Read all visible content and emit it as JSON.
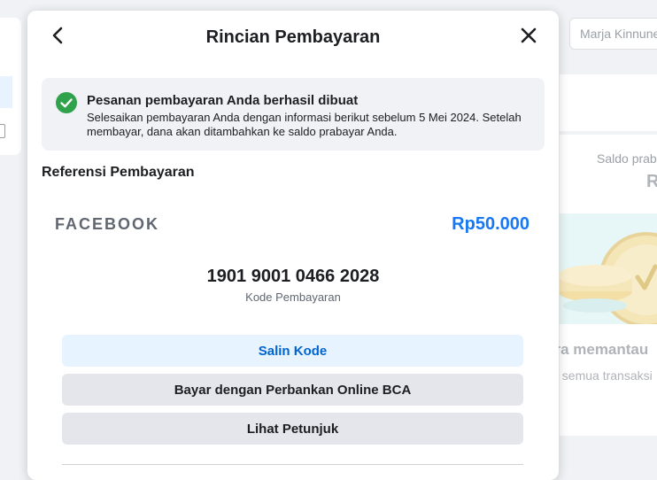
{
  "background": {
    "search_placeholder": "Marja Kinnunen",
    "saldo_label": "Saldo prabayar",
    "saldo_value": "R",
    "heading": "ara memantau",
    "sub": "t semua transaksi"
  },
  "modal": {
    "title": "Rincian Pembayaran",
    "back_icon": "chevron-left-icon",
    "close_icon": "close-icon"
  },
  "banner": {
    "title": "Pesanan pembayaran Anda berhasil dibuat",
    "description": "Selesaikan pembayaran Anda dengan informasi berikut sebelum 5 Mei 2024. Setelah membayar, dana akan ditambahkan ke saldo prabayar Anda.",
    "icon": "check-circle-icon",
    "icon_color": "#31a24c"
  },
  "reference": {
    "section_title": "Referensi Pembayaran",
    "merchant": "FACEBOOK",
    "amount": "Rp50.000",
    "amount_color": "#1877f2",
    "payment_code": "1901 9001 0466 2028",
    "payment_code_label": "Kode Pembayaran"
  },
  "actions": {
    "copy_label": "Salin Kode",
    "bank_label": "Bayar dengan Perbankan Online BCA",
    "guide_label": "Lihat Petunjuk"
  }
}
